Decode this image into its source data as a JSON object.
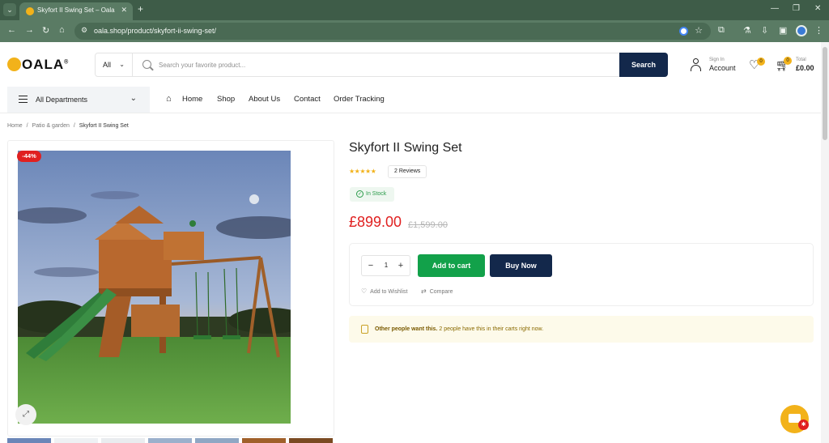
{
  "browser": {
    "tab_title": "Skyfort II Swing Set – Oala",
    "url": "oala.shop/product/skyfort-ii-swing-set/",
    "colors": {
      "frame": "#3e5c48",
      "toolbar": "#5a7b64"
    }
  },
  "header": {
    "logo_text": "OALA",
    "logo_mark": "®",
    "search": {
      "category": "All",
      "placeholder": "Search your favorite product...",
      "button_label": "Search"
    },
    "account": {
      "small": "Sign In",
      "label": "Account"
    },
    "wishlist": {
      "count": "0"
    },
    "cart": {
      "count": "0",
      "small": "Total",
      "total": "£0.00"
    }
  },
  "nav": {
    "departments_label": "All Departments",
    "links": [
      "Home",
      "Shop",
      "About Us",
      "Contact",
      "Order Tracking"
    ]
  },
  "breadcrumb": {
    "items": [
      "Home",
      "Patio & garden"
    ],
    "separator": "/",
    "current": "Skyfort II Swing Set"
  },
  "gallery": {
    "sale_badge": "-44%",
    "thumbnails": 7
  },
  "product": {
    "title": "Skyfort II Swing Set",
    "rating_stars": "★★★★★",
    "rating": 5,
    "reviews_label": "2 Reviews",
    "stock_label": "In Stock",
    "price": "£899.00",
    "old_price": "£1,599.00",
    "quantity": "1",
    "add_to_cart_label": "Add to cart",
    "buy_now_label": "Buy Now",
    "wishlist_label": "Add to Wishlist",
    "compare_label": "Compare"
  },
  "notice": {
    "strong": "Other people want this.",
    "text": " 2 people have this in their carts right now."
  },
  "colors": {
    "brand_yellow": "#f2b21a",
    "navy": "#13284b",
    "green": "#12a14a",
    "sale_red": "#e02020"
  }
}
